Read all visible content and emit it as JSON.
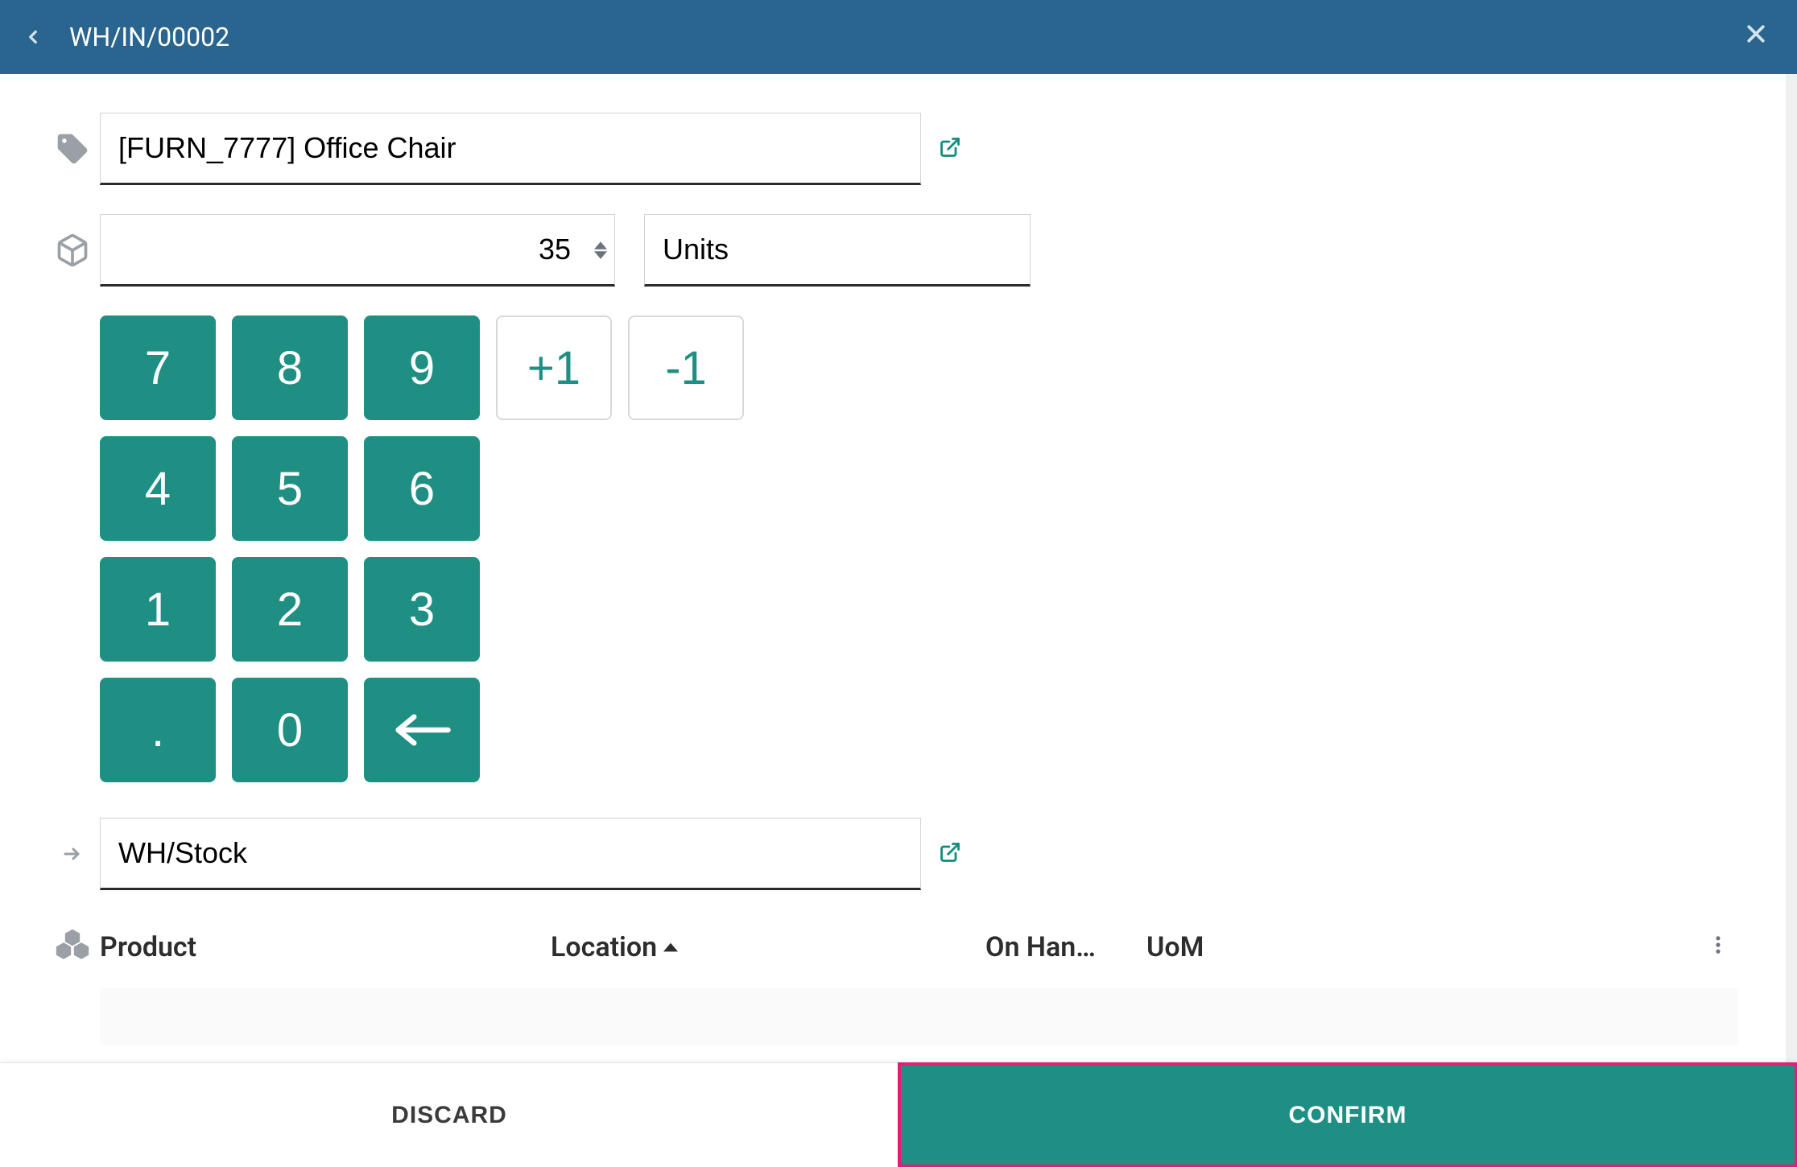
{
  "header": {
    "title": "WH/IN/00002"
  },
  "product": {
    "value": "[FURN_7777] Office Chair"
  },
  "quantity": {
    "value": "35",
    "uom": "Units"
  },
  "numpad": {
    "keys": [
      "7",
      "8",
      "9",
      "+1",
      "-1",
      "4",
      "5",
      "6",
      "",
      "",
      "1",
      "2",
      "3",
      "",
      "",
      ".",
      "0",
      "backspace",
      "",
      ""
    ]
  },
  "location": {
    "value": "WH/Stock"
  },
  "table": {
    "columns": {
      "product": "Product",
      "location": "Location",
      "onhand": "On Han…",
      "uom": "UoM"
    }
  },
  "footer": {
    "discard": "DISCARD",
    "confirm": "CONFIRM"
  }
}
